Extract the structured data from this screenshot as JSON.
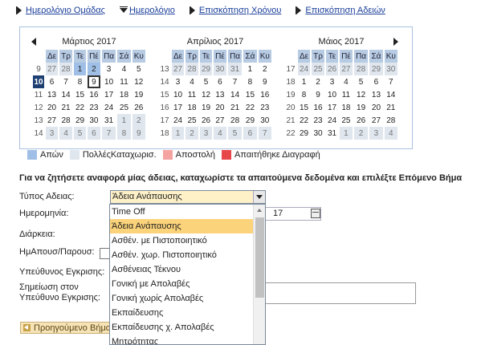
{
  "nav": {
    "items": [
      {
        "label": "Ημερολόγιο Ομάδας",
        "icon": "right-arrow-icon"
      },
      {
        "label": "Ημερολόγιο",
        "icon": "down-arrow-icon"
      },
      {
        "label": "Επισκόπηση Χρόνου",
        "icon": "right-arrow-icon"
      },
      {
        "label": "Επισκόπηση Αδειών",
        "icon": "right-arrow-icon"
      }
    ]
  },
  "calendar": {
    "day_headers": [
      "Δε",
      "Τρ",
      "Τε",
      "Πέ",
      "Πα",
      "Σά",
      "Κυ"
    ],
    "months": [
      {
        "title": "Μάρτιος 2017",
        "weeks": [
          {
            "wk": "9",
            "days": [
              [
                "27",
                "other"
              ],
              [
                "28",
                "other"
              ],
              [
                "1",
                "hl"
              ],
              [
                "2",
                "hl"
              ],
              [
                "3",
                ""
              ],
              [
                "4",
                ""
              ],
              [
                "5",
                ""
              ]
            ]
          },
          {
            "wk": "10",
            "wkcur": true,
            "days": [
              [
                "6",
                ""
              ],
              [
                "7",
                ""
              ],
              [
                "8",
                ""
              ],
              [
                "9",
                "today"
              ],
              [
                "10",
                ""
              ],
              [
                "11",
                ""
              ],
              [
                "12",
                ""
              ]
            ]
          },
          {
            "wk": "11",
            "days": [
              [
                "13",
                ""
              ],
              [
                "14",
                ""
              ],
              [
                "15",
                ""
              ],
              [
                "16",
                ""
              ],
              [
                "17",
                ""
              ],
              [
                "18",
                ""
              ],
              [
                "19",
                ""
              ]
            ]
          },
          {
            "wk": "12",
            "days": [
              [
                "20",
                ""
              ],
              [
                "21",
                ""
              ],
              [
                "22",
                ""
              ],
              [
                "23",
                ""
              ],
              [
                "24",
                ""
              ],
              [
                "25",
                ""
              ],
              [
                "26",
                ""
              ]
            ]
          },
          {
            "wk": "13",
            "days": [
              [
                "27",
                ""
              ],
              [
                "28",
                ""
              ],
              [
                "29",
                ""
              ],
              [
                "30",
                ""
              ],
              [
                "31",
                ""
              ],
              [
                "1",
                "other"
              ],
              [
                "2",
                "other"
              ]
            ]
          },
          {
            "wk": "14",
            "days": [
              [
                "3",
                "other"
              ],
              [
                "4",
                "other"
              ],
              [
                "5",
                "other"
              ],
              [
                "6",
                "other"
              ],
              [
                "7",
                "other"
              ],
              [
                "8",
                "other"
              ],
              [
                "9",
                "other"
              ]
            ]
          }
        ]
      },
      {
        "title": "Απρίλιος 2017",
        "weeks": [
          {
            "wk": "13",
            "days": [
              [
                "27",
                "other"
              ],
              [
                "28",
                "other"
              ],
              [
                "29",
                "other"
              ],
              [
                "30",
                "other"
              ],
              [
                "31",
                "other"
              ],
              [
                "1",
                ""
              ],
              [
                "2",
                ""
              ]
            ]
          },
          {
            "wk": "14",
            "days": [
              [
                "3",
                ""
              ],
              [
                "4",
                ""
              ],
              [
                "5",
                ""
              ],
              [
                "6",
                ""
              ],
              [
                "7",
                ""
              ],
              [
                "8",
                ""
              ],
              [
                "9",
                ""
              ]
            ]
          },
          {
            "wk": "15",
            "days": [
              [
                "10",
                ""
              ],
              [
                "11",
                ""
              ],
              [
                "12",
                ""
              ],
              [
                "13",
                ""
              ],
              [
                "14",
                ""
              ],
              [
                "15",
                ""
              ],
              [
                "16",
                ""
              ]
            ]
          },
          {
            "wk": "16",
            "days": [
              [
                "17",
                ""
              ],
              [
                "18",
                ""
              ],
              [
                "19",
                ""
              ],
              [
                "20",
                ""
              ],
              [
                "21",
                ""
              ],
              [
                "22",
                ""
              ],
              [
                "23",
                ""
              ]
            ]
          },
          {
            "wk": "17",
            "days": [
              [
                "24",
                ""
              ],
              [
                "25",
                ""
              ],
              [
                "26",
                ""
              ],
              [
                "27",
                ""
              ],
              [
                "28",
                ""
              ],
              [
                "29",
                ""
              ],
              [
                "30",
                ""
              ]
            ]
          },
          {
            "wk": "18",
            "days": [
              [
                "1",
                "other"
              ],
              [
                "2",
                "other"
              ],
              [
                "3",
                "other"
              ],
              [
                "4",
                "other"
              ],
              [
                "5",
                "other"
              ],
              [
                "6",
                "other"
              ],
              [
                "7",
                "other"
              ]
            ]
          }
        ]
      },
      {
        "title": "Μάιος 2017",
        "weeks": [
          {
            "wk": "17",
            "days": [
              [
                "24",
                "other"
              ],
              [
                "25",
                "other"
              ],
              [
                "26",
                "other"
              ],
              [
                "27",
                "other"
              ],
              [
                "28",
                "other"
              ],
              [
                "29",
                "other"
              ],
              [
                "30",
                "other"
              ]
            ]
          },
          {
            "wk": "18",
            "days": [
              [
                "1",
                ""
              ],
              [
                "2",
                ""
              ],
              [
                "3",
                ""
              ],
              [
                "4",
                ""
              ],
              [
                "5",
                ""
              ],
              [
                "6",
                ""
              ],
              [
                "7",
                ""
              ]
            ]
          },
          {
            "wk": "19",
            "days": [
              [
                "8",
                ""
              ],
              [
                "9",
                ""
              ],
              [
                "10",
                ""
              ],
              [
                "11",
                ""
              ],
              [
                "12",
                ""
              ],
              [
                "13",
                ""
              ],
              [
                "14",
                ""
              ]
            ]
          },
          {
            "wk": "20",
            "days": [
              [
                "15",
                ""
              ],
              [
                "16",
                ""
              ],
              [
                "17",
                ""
              ],
              [
                "18",
                ""
              ],
              [
                "19",
                ""
              ],
              [
                "20",
                ""
              ],
              [
                "21",
                ""
              ]
            ]
          },
          {
            "wk": "21",
            "days": [
              [
                "22",
                ""
              ],
              [
                "23",
                ""
              ],
              [
                "24",
                ""
              ],
              [
                "25",
                ""
              ],
              [
                "26",
                ""
              ],
              [
                "27",
                ""
              ],
              [
                "28",
                ""
              ]
            ]
          },
          {
            "wk": "22",
            "days": [
              [
                "29",
                ""
              ],
              [
                "30",
                ""
              ],
              [
                "31",
                ""
              ],
              [
                "1",
                "other"
              ],
              [
                "2",
                "other"
              ],
              [
                "3",
                "other"
              ],
              [
                "4",
                "other"
              ]
            ]
          }
        ]
      }
    ]
  },
  "legend": [
    {
      "label": "Απών",
      "color": "#9fbfe6"
    },
    {
      "label": "ΠολλέςΚαταχωρισ.",
      "color": "#dfe6ee"
    },
    {
      "label": "Αποστολή",
      "color": "#f4a3a0"
    },
    {
      "label": "Απαιτήθηκε Διαγραφή",
      "color": "#e8474a"
    }
  ],
  "instruction": "Για να ζητήσετε αναφορά μίας άδειας, καταχωρίστε τα απαιτούμενα δεδομένα και επιλέξτε Επόμενο Βήμα",
  "form": {
    "leave_type_label": "Τύπος Αδειας:",
    "leave_type_value": "Άδεια Ανάπαυσης",
    "date_label": "Ημερομηνία:",
    "date_visible_tail": "17",
    "duration_label": "Διάρκεια:",
    "half_day_label": "ΗμΑπουσ/Παρουσ:",
    "approver_label": "Υπεύθυνος Εγκρισης:",
    "note_label_line1": "Σημείωση στον",
    "note_label_line2": "Υπεύθυνο Εγκρισης:",
    "prev_button": "Προηγούμενο Βήμα"
  },
  "dropdown": {
    "options": [
      "Time Off",
      "Άδεια Ανάπαυσης",
      "Ασθέν. με Πιστοποιητικό",
      "Ασθέν. χωρ. Πιστοποιητικό",
      "Ασθένειας Τέκνου",
      "Γονική με Απολαβές",
      "Γονική χωρίς Απολαβές",
      "Εκπαίδευσης",
      "Εκπαίδευσης χ. Απολαβές",
      "Μητρότητας"
    ],
    "selected_index": 1
  }
}
